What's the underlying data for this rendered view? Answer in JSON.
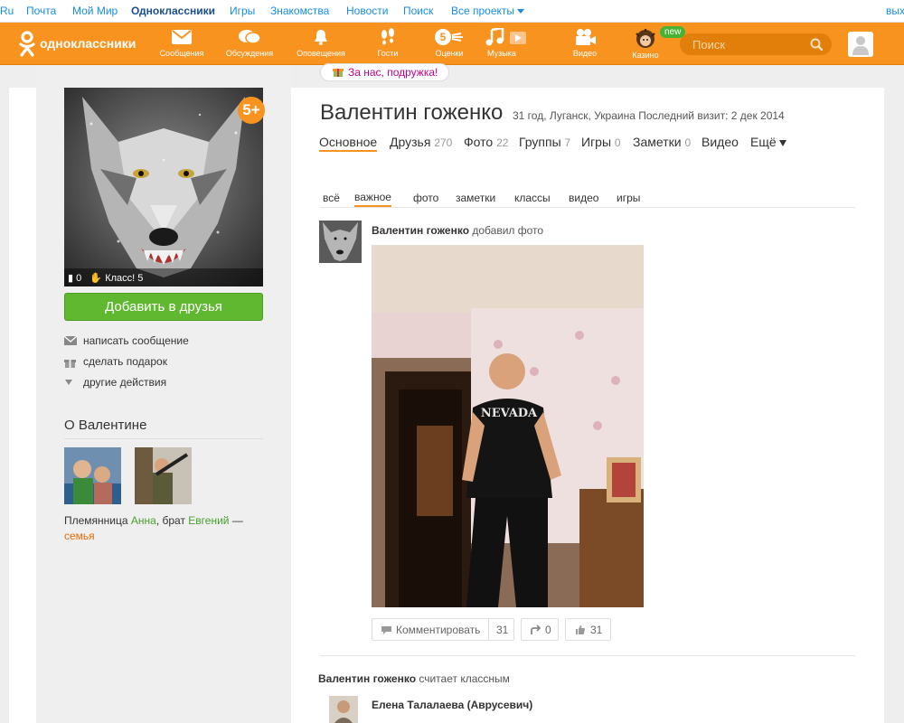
{
  "topbar": {
    "links": [
      "Ru",
      "Почта",
      "Мой Мир",
      "Одноклассники",
      "Игры",
      "Знакомства",
      "Новости",
      "Поиск",
      "Все проекты",
      "вых"
    ]
  },
  "toolbar": {
    "logo_text": "одноклассники",
    "nav": [
      "Сообщения",
      "Обсуждения",
      "Оповещения",
      "Гости",
      "Оценки",
      "Музыка",
      "Видео",
      "Казино"
    ],
    "new_badge": "new",
    "search_placeholder": "Поиск"
  },
  "tooltip": "За нас, подружка!",
  "profile": {
    "age_badge": "5+",
    "avatar_comments": "0",
    "avatar_klass": "Класс! 5",
    "add_friend": "Добавить в друзья",
    "actions": [
      "написать сообщение",
      "сделать подарок",
      "другие действия"
    ],
    "about_title": "О Валентине",
    "relations": {
      "prefix": "Племянница ",
      "niece": "Анна",
      "middle": ", брат ",
      "brother": "Евгений",
      "suffix": " —",
      "family": "семья"
    },
    "name": "Валентин гоженко",
    "meta": "31 год, Луганск, Украина  Последний визит: 2 дек 2014"
  },
  "profile_tabs": [
    {
      "label": "Основное",
      "count": ""
    },
    {
      "label": "Друзья",
      "count": "270"
    },
    {
      "label": "Фото",
      "count": "22"
    },
    {
      "label": "Группы",
      "count": "7"
    },
    {
      "label": "Игры",
      "count": "0"
    },
    {
      "label": "Заметки",
      "count": "0"
    },
    {
      "label": "Видео",
      "count": ""
    },
    {
      "label": "Ещё",
      "count": ""
    }
  ],
  "feed_tabs": [
    "всё",
    "важное",
    "фото",
    "заметки",
    "классы",
    "видео",
    "игры"
  ],
  "feed": {
    "post1": {
      "author": "Валентин гоженко",
      "action": " добавил фото"
    },
    "comment_label": "Комментировать",
    "comment_count": "31",
    "share_count": "0",
    "like_count": "31",
    "post2": {
      "author": "Валентин гоженко",
      "action": " считает классным"
    },
    "post2_name": "Елена Талалаева (Аврусевич)"
  },
  "colors": {
    "brand": "#f7931e",
    "green": "#5fb830",
    "link_blue": "#168de2"
  }
}
